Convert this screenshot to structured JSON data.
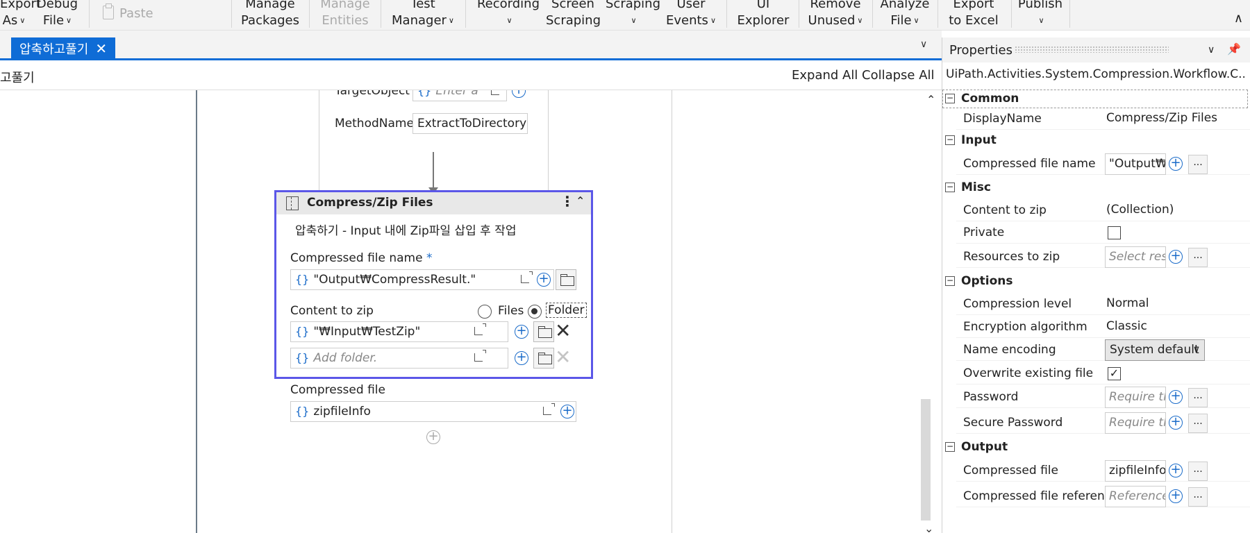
{
  "ribbon": {
    "export_as": [
      "Export",
      "As"
    ],
    "debug_file": [
      "Debug",
      "File"
    ],
    "paste": "Paste",
    "manage_packages": [
      "Manage",
      "Packages"
    ],
    "manage_entities": [
      "Manage",
      "Entities"
    ],
    "test_manager": [
      "Test",
      "Manager"
    ],
    "recording": [
      "Recording",
      ""
    ],
    "screen_scraping": [
      "Screen",
      "Scraping"
    ],
    "data_scraping": [
      "Scraping",
      ""
    ],
    "user_events": [
      "User",
      "Events"
    ],
    "ui_explorer": [
      "UI",
      "Explorer"
    ],
    "remove_unused": [
      "Remove",
      "Unused"
    ],
    "analyze_file": [
      "Analyze",
      "File"
    ],
    "export_to_excel": [
      "Export",
      "to Excel"
    ],
    "publish": [
      "Publish",
      ""
    ]
  },
  "document": {
    "tab_title": "압축하고풀기",
    "breadcrumb": "고풀기",
    "expand_all": "Expand All",
    "collapse_all": "Collapse All"
  },
  "invoke": {
    "target_object_label": "TargetObject",
    "target_object_placeholder": "Enter a",
    "method_name_label": "MethodName",
    "method_name_value": "ExtractToDirectory"
  },
  "activity": {
    "title": "Compress/Zip Files",
    "display_name": "압축하기 - Input 내에 Zip파일 삽입 후 작업",
    "compressed_file_name_label": "Compressed file name",
    "required_mark": "*",
    "compressed_file_name_value": "\"Output₩CompressResult.\"",
    "content_to_zip_label": "Content to zip",
    "option_files": "Files",
    "option_folder": "Folder",
    "folder_value": "\"₩Input₩TestZip\"",
    "add_folder_placeholder": "Add folder.",
    "compressed_file_label": "Compressed file",
    "compressed_file_value": "zipfileInfo"
  },
  "properties": {
    "title": "Properties",
    "type_name": "UiPath.Activities.System.Compression.Workflow.C...",
    "categories": {
      "common": "Common",
      "input": "Input",
      "misc": "Misc",
      "options": "Options",
      "output": "Output"
    },
    "rows": {
      "display_name": {
        "name": "DisplayName",
        "value": "Compress/Zip Files"
      },
      "compressed_file_name": {
        "name": "Compressed file name",
        "value": "\"Output₩C"
      },
      "content_to_zip": {
        "name": "Content to zip",
        "value": "(Collection)"
      },
      "private": {
        "name": "Private"
      },
      "resources_to_zip": {
        "name": "Resources to zip",
        "placeholder": "Select resc"
      },
      "compression_level": {
        "name": "Compression level",
        "value": "Normal"
      },
      "encryption_algorithm": {
        "name": "Encryption algorithm",
        "value": "Classic"
      },
      "name_encoding": {
        "name": "Name encoding",
        "value": "System default"
      },
      "overwrite_existing_file": {
        "name": "Overwrite existing file",
        "checked": true
      },
      "password": {
        "name": "Password",
        "placeholder": "Require th"
      },
      "secure_password": {
        "name": "Secure Password",
        "placeholder": "Require th"
      },
      "compressed_file": {
        "name": "Compressed file",
        "value": "zipfileInfo"
      },
      "compressed_file_reference": {
        "name": "Compressed file reference",
        "placeholder": "Reference"
      }
    },
    "dots_label": "..."
  },
  "icons": [
    "clipboard-icon",
    "close-icon",
    "chevron-down-icon",
    "chevron-up-icon",
    "expression-brace-icon",
    "expand-editor-icon",
    "plus-circle-icon",
    "folder-icon",
    "zip-activity-icon",
    "more-vert-icon",
    "collapse-icon",
    "pin-icon",
    "checkbox-icon"
  ],
  "colors": {
    "accent": "#0f6cd6",
    "selection": "#5b57e8",
    "expression": "#1a6bc9"
  }
}
